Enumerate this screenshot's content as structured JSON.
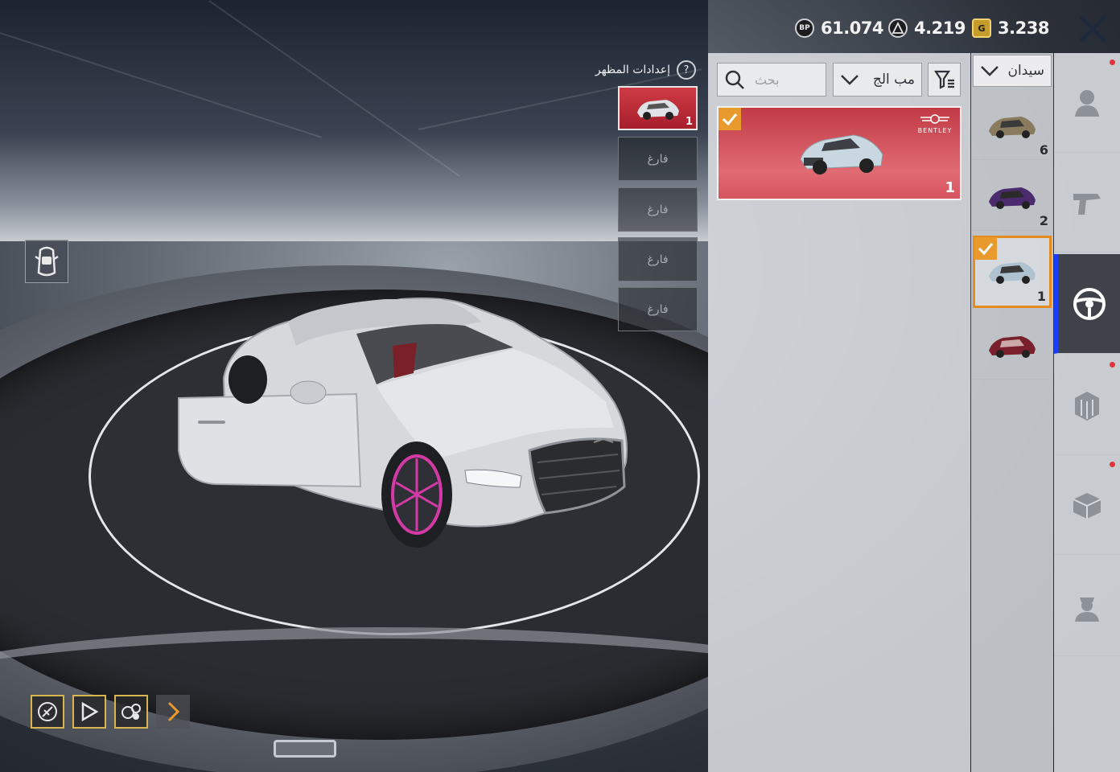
{
  "currency": [
    {
      "icon": "bp-coin-icon",
      "label": "BP",
      "value": "61.074"
    },
    {
      "icon": "ag-coin-icon",
      "label": "",
      "value": "4.219"
    },
    {
      "icon": "uc-coin-icon",
      "label": "",
      "value": "3.238"
    }
  ],
  "appearance": {
    "title": "إعدادات المظهر",
    "help": "?",
    "slots": [
      {
        "label": "",
        "count": "1",
        "active": true
      },
      {
        "label": "فارغ"
      },
      {
        "label": "فارغ"
      },
      {
        "label": "فارغ"
      },
      {
        "label": "فارغ"
      }
    ]
  },
  "toolbar": {
    "search_placeholder": "بحث",
    "sort_label": "مب الج",
    "category_label": "سيدان"
  },
  "item_card": {
    "brand": "BENTLEY",
    "count": "1",
    "checked": true
  },
  "vehicles": [
    {
      "count": "6",
      "color": "#8a7a5e"
    },
    {
      "count": "2",
      "color": "#4b2a6e"
    },
    {
      "count": "1",
      "color": "#aec3cf",
      "selected": true
    },
    {
      "count": "",
      "color": "#7a1f2c"
    }
  ],
  "colors": {
    "accent": "#e48b22",
    "active_tab": "#1c3cff",
    "item_red": "#c13a46",
    "dot": "#e0343c"
  }
}
